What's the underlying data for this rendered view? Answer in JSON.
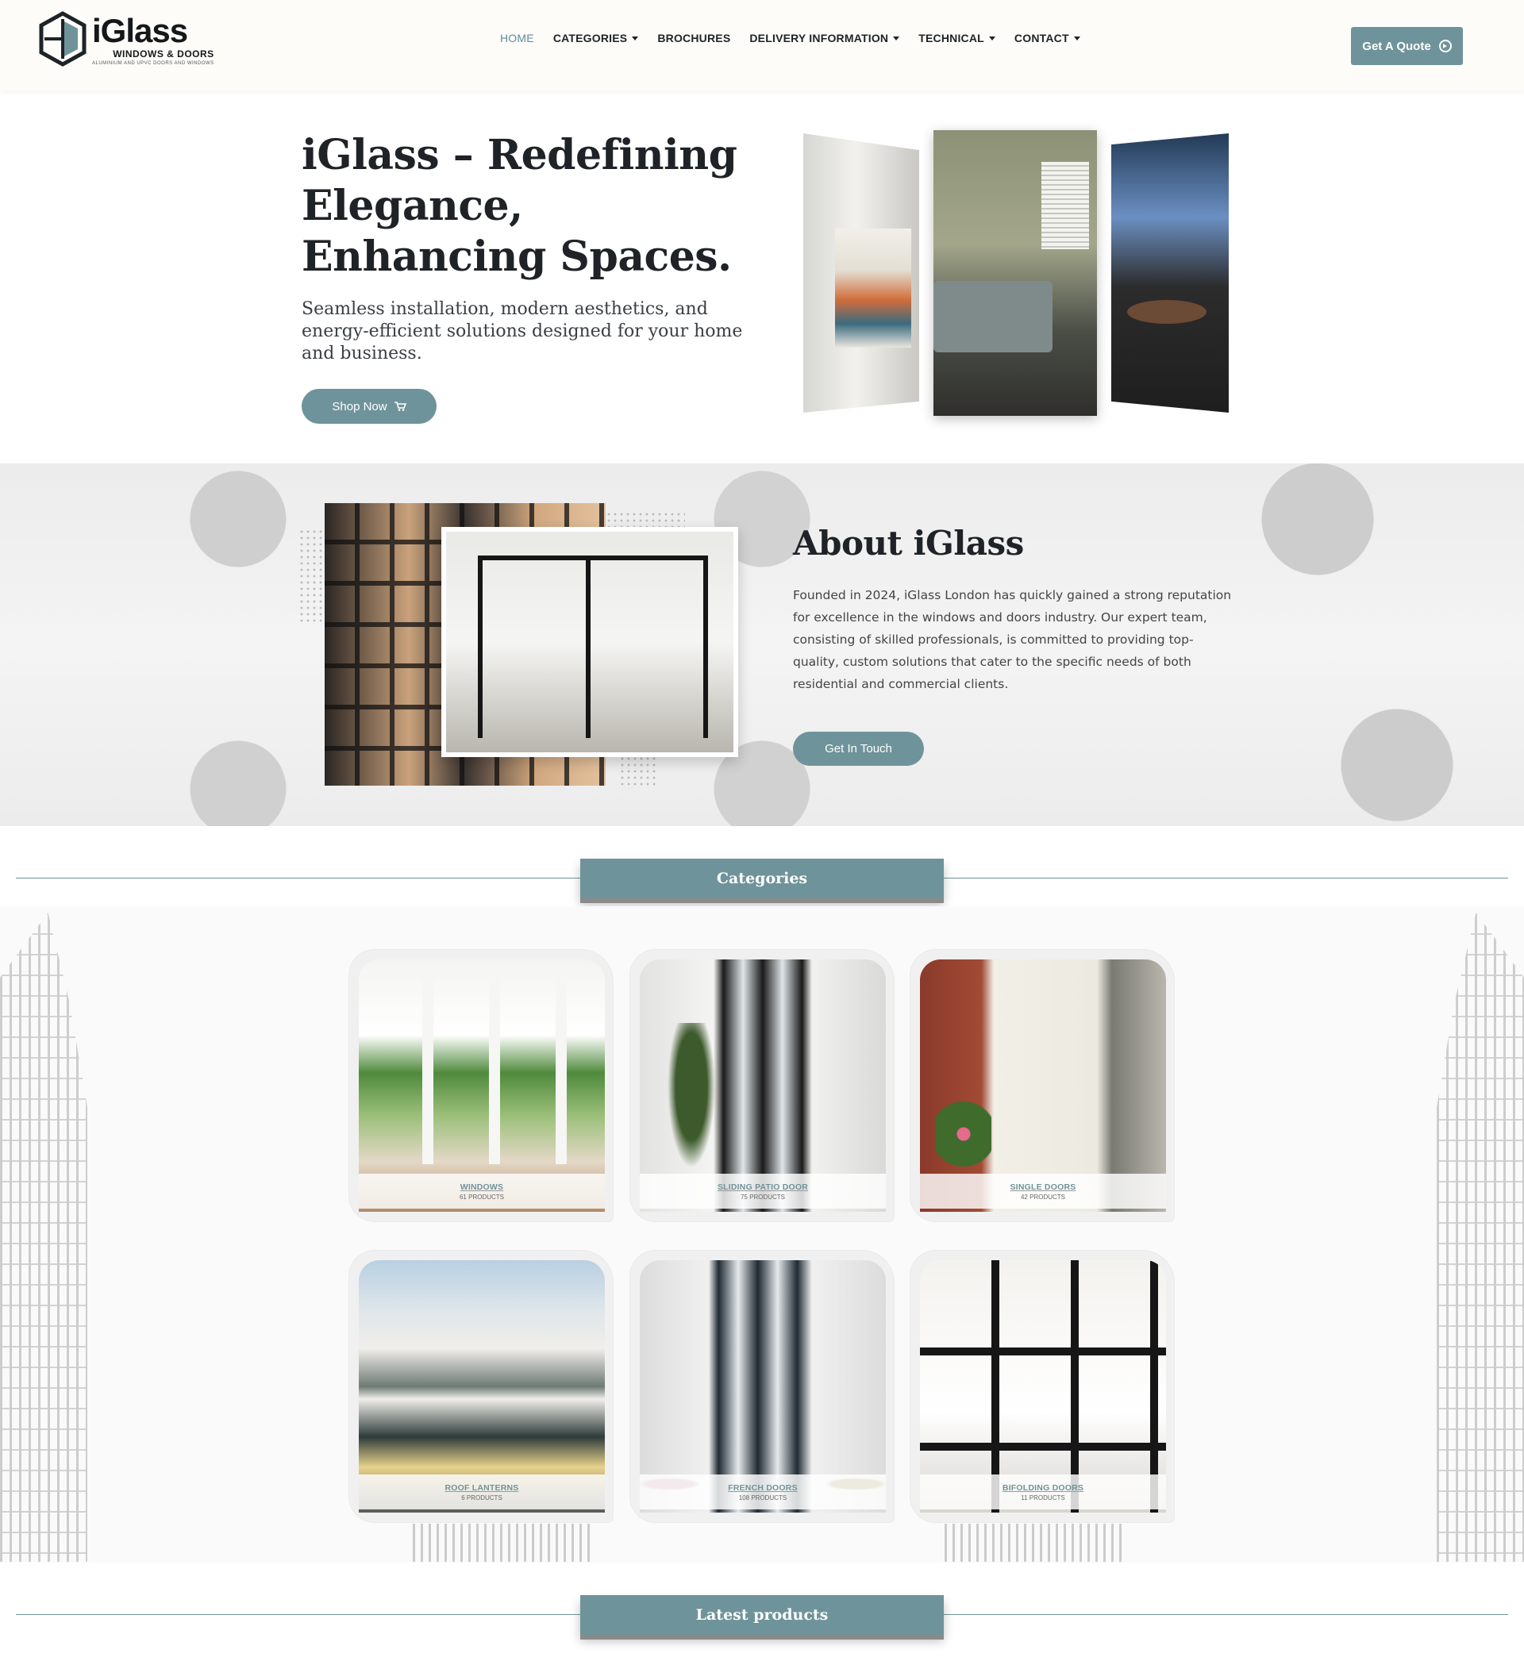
{
  "header": {
    "logo": {
      "word": "iGlass",
      "sub": "WINDOWS & DOORS",
      "tagline": "ALUMINIUM AND UPVC DOORS AND WINDOWS"
    },
    "nav": [
      {
        "label": "HOME",
        "active": true,
        "dropdown": false
      },
      {
        "label": "CATEGORIES",
        "active": false,
        "dropdown": true
      },
      {
        "label": "BROCHURES",
        "active": false,
        "dropdown": false
      },
      {
        "label": "DELIVERY INFORMATION",
        "active": false,
        "dropdown": true
      },
      {
        "label": "TECHNICAL",
        "active": false,
        "dropdown": true
      },
      {
        "label": "CONTACT",
        "active": false,
        "dropdown": true
      }
    ],
    "quote_button": "Get A Quote"
  },
  "hero": {
    "title": "iGlass – Redefining Elegance, Enhancing Spaces.",
    "subtitle": "Seamless installation, modern aesthetics, and energy-efficient solutions designed for your home and business.",
    "cta": "Shop Now"
  },
  "about": {
    "title": "About iGlass",
    "text": "Founded in 2024, iGlass London has quickly gained a strong reputation for excellence in the windows and doors industry. Our expert team, consisting of skilled professionals, is committed to providing top-quality, custom solutions that cater to the specific needs of both residential and commercial clients.",
    "cta": "Get In Touch"
  },
  "categories": {
    "heading": "Categories",
    "items": [
      {
        "name": "WINDOWS",
        "count": "61 PRODUCTS"
      },
      {
        "name": "SLIDING PATIO DOOR",
        "count": "75 PRODUCTS"
      },
      {
        "name": "SINGLE DOORS",
        "count": "42 PRODUCTS"
      },
      {
        "name": "ROOF LANTERNS",
        "count": "6 PRODUCTS"
      },
      {
        "name": "FRENCH DOORS",
        "count": "108 PRODUCTS"
      },
      {
        "name": "BIFOLDING DOORS",
        "count": "11 PRODUCTS"
      }
    ]
  },
  "latest": {
    "heading": "Latest products"
  },
  "colors": {
    "accent": "#6f939a",
    "text": "#1f2328",
    "header_bg": "#fdfcf9"
  }
}
